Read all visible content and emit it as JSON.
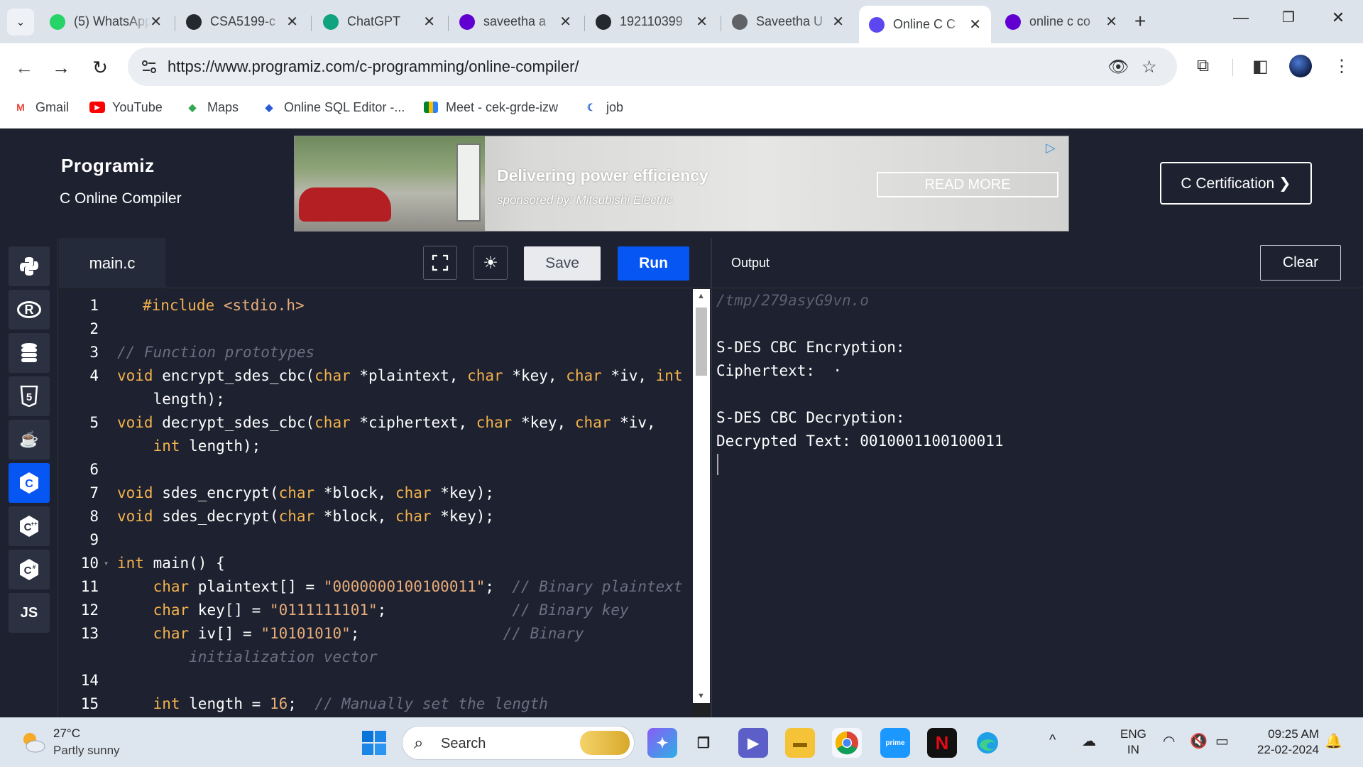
{
  "browser": {
    "tabs": [
      {
        "title": "(5) WhatsApp",
        "icon": "whatsapp-icon",
        "color": "#25d366"
      },
      {
        "title": "CSA5199-c",
        "icon": "github-icon",
        "color": "#24292f"
      },
      {
        "title": "ChatGPT",
        "icon": "chatgpt-icon",
        "color": "#10a37f"
      },
      {
        "title": "saveetha a",
        "icon": "yahoo-icon",
        "color": "#6001d2"
      },
      {
        "title": "192110399",
        "icon": "github-icon",
        "color": "#24292f"
      },
      {
        "title": "Saveetha U",
        "icon": "globe-icon",
        "color": "#5f6368"
      },
      {
        "title": "Online C C",
        "icon": "programiz-icon",
        "color": "#5b46f0",
        "active": true
      },
      {
        "title": "online c co",
        "icon": "yahoo-icon",
        "color": "#6001d2"
      }
    ],
    "url": "https://www.programiz.com/c-programming/online-compiler/",
    "bookmarks": [
      {
        "label": "Gmail",
        "icon": "gmail-icon"
      },
      {
        "label": "YouTube",
        "icon": "youtube-icon"
      },
      {
        "label": "Maps",
        "icon": "maps-icon"
      },
      {
        "label": "Online SQL Editor -...",
        "icon": "sql-editor-icon"
      },
      {
        "label": "Meet - cek-grde-izw",
        "icon": "meet-icon"
      },
      {
        "label": "job",
        "icon": "job-icon"
      }
    ]
  },
  "header": {
    "logo": "Programiz",
    "subtitle": "C Online Compiler",
    "certification_label": "C Certification ❯"
  },
  "ad": {
    "title": "Delivering power efficiency",
    "sponsor": "sponsored by: Mitsubishi Electric",
    "button": "READ MORE"
  },
  "languages": [
    {
      "name": "python-icon",
      "glyph": "🐍"
    },
    {
      "name": "r-icon",
      "glyph": "R"
    },
    {
      "name": "sql-icon",
      "glyph": "☰"
    },
    {
      "name": "html-icon",
      "glyph": "5"
    },
    {
      "name": "java-icon",
      "glyph": "☕"
    },
    {
      "name": "c-icon",
      "glyph": "C",
      "active": true
    },
    {
      "name": "cpp-icon",
      "glyph": "C+"
    },
    {
      "name": "csharp-icon",
      "glyph": "C#"
    },
    {
      "name": "js-icon",
      "glyph": "JS"
    }
  ],
  "editor": {
    "file_name": "main.c",
    "save_label": "Save",
    "run_label": "Run",
    "lines": [
      {
        "n": "1",
        "html": "<span class=\"pp\">#include</span> <span class=\"str\">&lt;stdio.h&gt;</span>",
        "indent": 1
      },
      {
        "n": "2",
        "html": ""
      },
      {
        "n": "3",
        "html": "<span class=\"cm\">// Function prototypes</span>"
      },
      {
        "n": "4",
        "html": "<span class=\"kw\">void</span> encrypt_sdes_cbc(<span class=\"kw\">char</span> *plaintext, <span class=\"kw\">char</span> *key, <span class=\"kw\">char</span> *iv, <span class=\"kw\">int</span>"
      },
      {
        "n": "",
        "html": "    length);"
      },
      {
        "n": "5",
        "html": "<span class=\"kw\">void</span> decrypt_sdes_cbc(<span class=\"kw\">char</span> *ciphertext, <span class=\"kw\">char</span> *key, <span class=\"kw\">char</span> *iv,"
      },
      {
        "n": "",
        "html": "    <span class=\"kw\">int</span> length);"
      },
      {
        "n": "6",
        "html": ""
      },
      {
        "n": "7",
        "html": "<span class=\"kw\">void</span> sdes_encrypt(<span class=\"kw\">char</span> *block, <span class=\"kw\">char</span> *key);"
      },
      {
        "n": "8",
        "html": "<span class=\"kw\">void</span> sdes_decrypt(<span class=\"kw\">char</span> *block, <span class=\"kw\">char</span> *key);"
      },
      {
        "n": "9",
        "html": ""
      },
      {
        "n": "10",
        "html": "<span class=\"kw\">int</span> main() {",
        "fold": true
      },
      {
        "n": "11",
        "html": "    <span class=\"kw\">char</span> plaintext[] = <span class=\"str\">\"0000000100100011\"</span>;  <span class=\"cm\">// Binary plaintext</span>"
      },
      {
        "n": "12",
        "html": "    <span class=\"kw\">char</span> key[] = <span class=\"str\">\"0111111101\"</span>;              <span class=\"cm\">// Binary key</span>"
      },
      {
        "n": "13",
        "html": "    <span class=\"kw\">char</span> iv[] = <span class=\"str\">\"10101010\"</span>;                <span class=\"cm\">// Binary</span>"
      },
      {
        "n": "",
        "html": "        <span class=\"cm\">initialization vector</span>"
      },
      {
        "n": "14",
        "html": ""
      },
      {
        "n": "15",
        "html": "    <span class=\"kw\">int</span> length = <span class=\"num\">16</span>;  <span class=\"cm\">// Manually set the length</span>"
      }
    ]
  },
  "output": {
    "label": "Output",
    "clear_label": "Clear",
    "lines": [
      {
        "text": "/tmp/279asyG9vn.o",
        "dim": true
      },
      {
        "text": ""
      },
      {
        "text": "S-DES CBC Encryption:"
      },
      {
        "text": "Ciphertext:  ·"
      },
      {
        "text": ""
      },
      {
        "text": "S-DES CBC Decryption:"
      },
      {
        "text": "Decrypted Text: 0010001100100011"
      }
    ]
  },
  "taskbar": {
    "temperature": "27°C",
    "weather": "Partly sunny",
    "search_placeholder": "Search",
    "lang_line1": "ENG",
    "lang_line2": "IN",
    "time": "09:25 AM",
    "date": "22-02-2024"
  }
}
